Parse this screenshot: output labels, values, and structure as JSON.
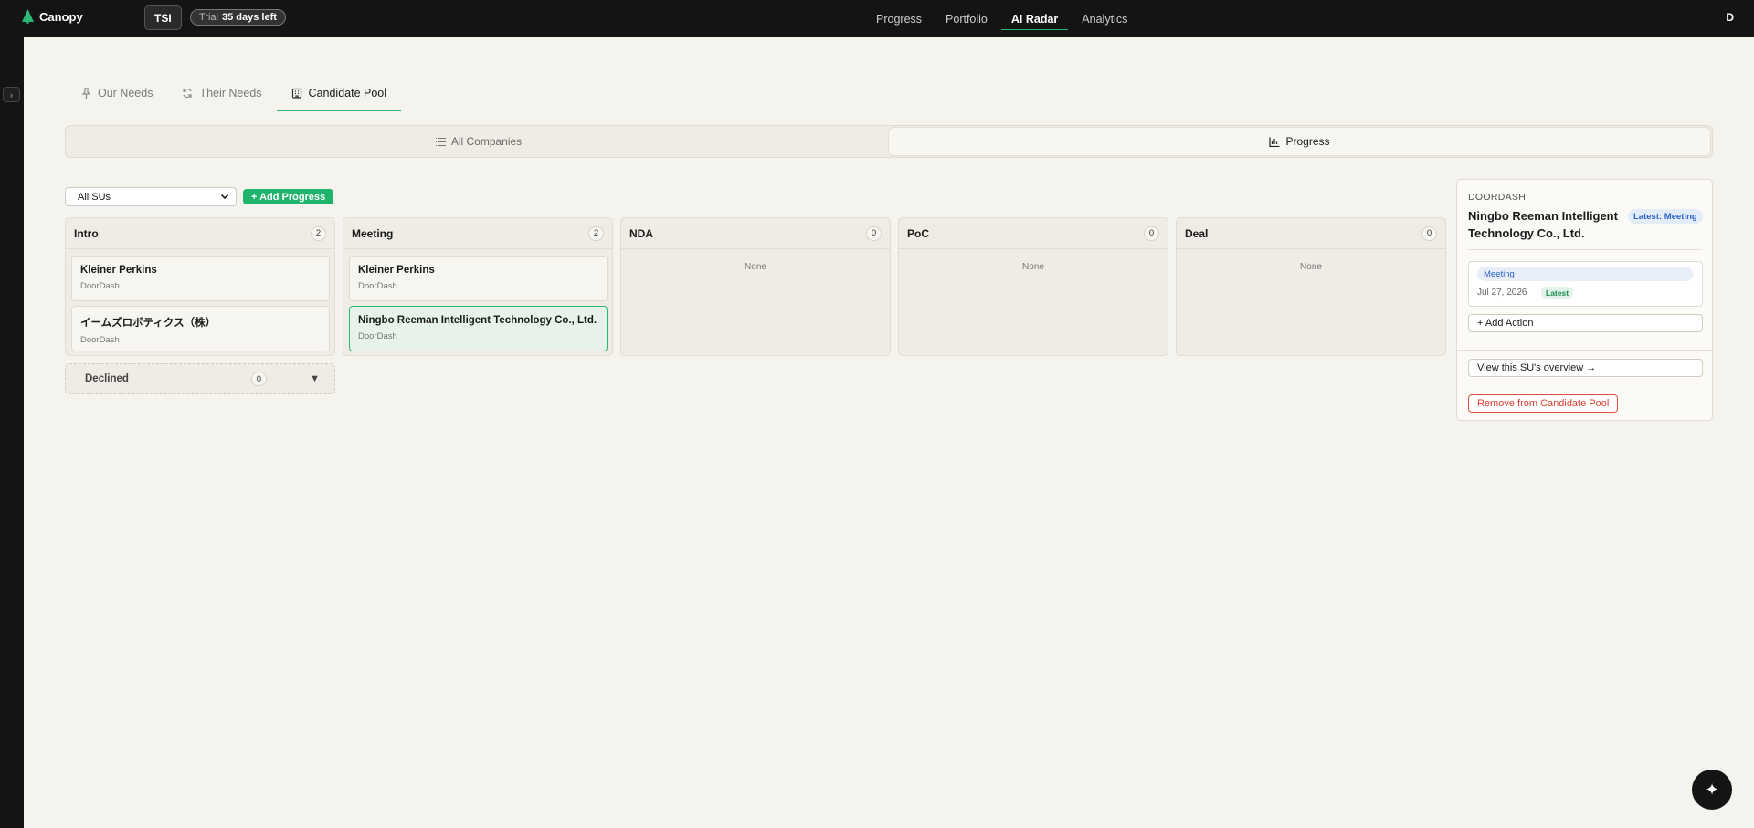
{
  "app": {
    "name": "Canopy"
  },
  "org": {
    "label": "TSI"
  },
  "trial": {
    "label": "Trial",
    "days": "35 days left"
  },
  "nav": {
    "items": [
      "Progress",
      "Portfolio",
      "AI Radar",
      "Analytics"
    ],
    "active": "AI Radar"
  },
  "user": {
    "initial": "D"
  },
  "rail": {
    "toggle": "›"
  },
  "tabs": [
    {
      "label": "Our Needs",
      "icon": "pin-icon"
    },
    {
      "label": "Their Needs",
      "icon": "refresh-icon"
    },
    {
      "label": "Candidate Pool",
      "icon": "building-icon",
      "active": true
    }
  ],
  "views": [
    {
      "label": "All Companies",
      "icon": "list-icon"
    },
    {
      "label": "Progress",
      "icon": "bar-chart-icon",
      "active": true
    }
  ],
  "filter": {
    "value": "All SUs"
  },
  "add_progress": "+ Add Progress",
  "columns": [
    {
      "title": "Intro",
      "count": "2",
      "cards": [
        {
          "title": "Kleiner Perkins",
          "sub": "DoorDash"
        },
        {
          "title": "イームズロボティクス（株）",
          "sub": "DoorDash"
        }
      ]
    },
    {
      "title": "Meeting",
      "count": "2",
      "cards": [
        {
          "title": "Kleiner Perkins",
          "sub": "DoorDash"
        },
        {
          "title": "Ningbo Reeman Intelligent Technology Co., Ltd.",
          "sub": "DoorDash",
          "selected": true
        }
      ]
    },
    {
      "title": "NDA",
      "count": "0",
      "empty": "None"
    },
    {
      "title": "PoC",
      "count": "0",
      "empty": "None"
    },
    {
      "title": "Deal",
      "count": "0",
      "empty": "None"
    }
  ],
  "declined": {
    "label": "Declined",
    "count": "0",
    "caret": "▼"
  },
  "panel": {
    "company": "DOORDASH",
    "name": "Ningbo Reeman Intelligent Technology Co., Ltd.",
    "latest_badge": "Latest: Meeting",
    "action": {
      "tag": "Meeting",
      "date": "Jul 27, 2026",
      "latest": "Latest"
    },
    "add_action": "+ Add Action",
    "view_overview": "View this SU's overview →",
    "remove": "Remove from Candidate Pool"
  },
  "fab": {
    "icon": "sparkle-icon",
    "glyph": "✦"
  },
  "colors": {
    "accent": "#2bb673",
    "primary_button": "#1fb36b",
    "danger": "#d8402f",
    "info": "#2b63c9"
  }
}
